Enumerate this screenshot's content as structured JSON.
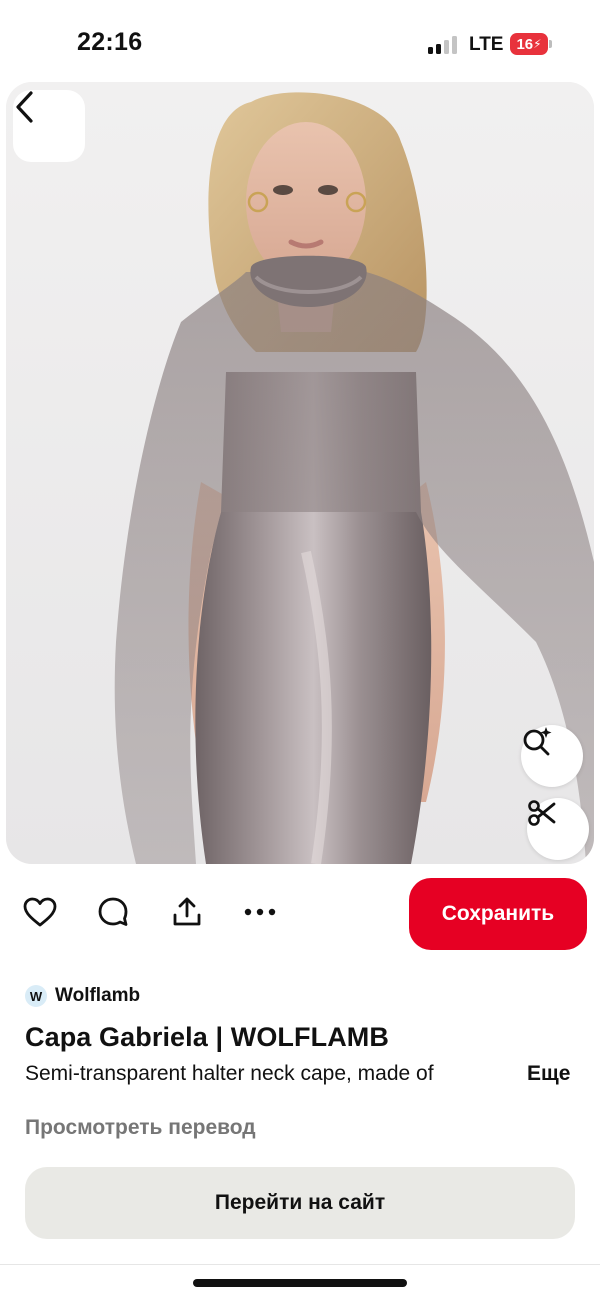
{
  "status_bar": {
    "time": "22:16",
    "network": "LTE",
    "battery": "16"
  },
  "pin": {
    "image_alt": "Model in satin slip dress with semi-transparent halter neck cape",
    "icons": {
      "back": "chevron-left-icon",
      "visual_search": "lens-sparkle-icon",
      "cutout": "scissors-icon"
    }
  },
  "actions": {
    "icons": [
      "heart-icon",
      "comment-icon",
      "share-icon",
      "more-icon"
    ],
    "save_label": "Сохранить"
  },
  "details": {
    "source_initial": "W",
    "source_name": "Wolflamb",
    "title": "Capa Gabriela | WOLFLAMB",
    "description": "Semi-transparent halter neck cape, made of",
    "more_label": "Еще",
    "translate_label": "Просмотреть перевод",
    "visit_label": "Перейти на сайт"
  },
  "colors": {
    "accent": "#e60023",
    "secondary_button": "#e9e9e5",
    "muted_text": "#767676",
    "battery": "#e8323c"
  }
}
